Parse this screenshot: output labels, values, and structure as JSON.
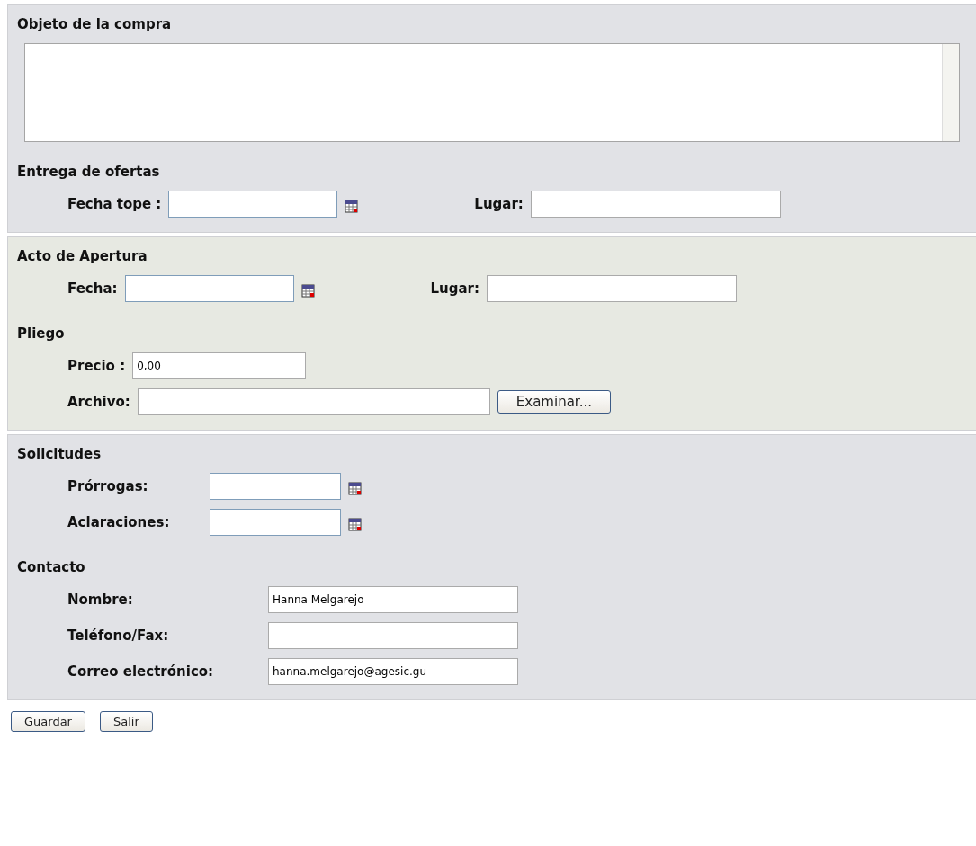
{
  "sections": [
    {
      "groups": [
        {
          "heading": "Objeto de la compra",
          "kind": "textarea"
        },
        {
          "heading": "Entrega de ofertas",
          "kind": "inline",
          "rows": [
            [
              {
                "label": "Fecha tope :",
                "calendar": true
              },
              {
                "label": "Lugar:",
                "calendar": false
              }
            ]
          ]
        }
      ]
    },
    {
      "groups": [
        {
          "heading": "Acto de Apertura",
          "kind": "inline",
          "rows": [
            [
              {
                "label": "Fecha:",
                "calendar": true
              },
              {
                "label": "Lugar:",
                "calendar": false
              }
            ]
          ]
        },
        {
          "heading": "Pliego",
          "kind": "inline",
          "rows": [
            [
              {
                "label": "Precio :",
                "value": "0,00",
                "calendar": false
              }
            ],
            [
              {
                "label": "Archivo:",
                "calendar": false,
                "button": "Examinar..."
              }
            ]
          ]
        }
      ]
    },
    {
      "groups": [
        {
          "heading": "Solicitudes",
          "kind": "aligned",
          "rows": [
            [
              {
                "label": "Prórrogas:",
                "calendar": true
              }
            ],
            [
              {
                "label": "Aclaraciones:",
                "calendar": true
              }
            ]
          ]
        },
        {
          "heading": "Contacto",
          "kind": "aligned",
          "rows": [
            [
              {
                "label": "Nombre:",
                "value": "Hanna Melgarejo",
                "calendar": false
              }
            ],
            [
              {
                "label": "Teléfono/Fax:",
                "calendar": false
              }
            ],
            [
              {
                "label": "Correo electrónico:",
                "value": "hanna.melgarejo@agesic.gu",
                "calendar": false
              }
            ]
          ]
        }
      ]
    }
  ],
  "buttons": [
    "Guardar",
    "Salir"
  ]
}
